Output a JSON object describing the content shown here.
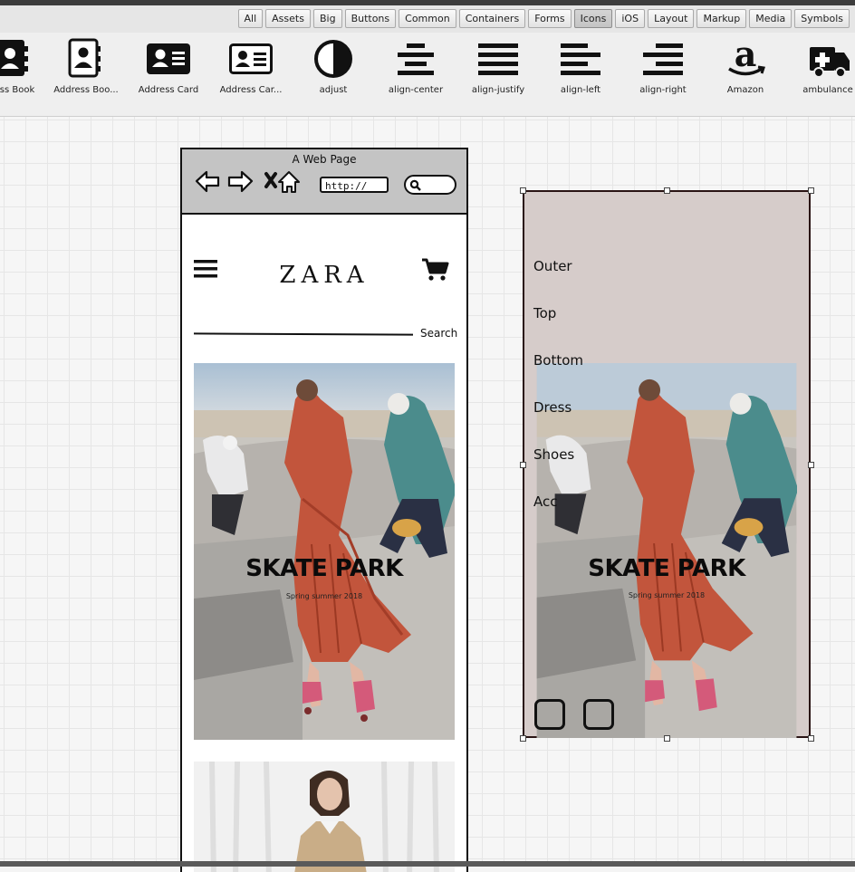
{
  "filter_tabs": [
    "All",
    "Assets",
    "Big",
    "Buttons",
    "Common",
    "Containers",
    "Forms",
    "Icons",
    "iOS",
    "Layout",
    "Markup",
    "Media",
    "Symbols"
  ],
  "active_filter": "Icons",
  "icon_library": [
    {
      "label": "ss Book",
      "icon": "address-book-icon"
    },
    {
      "label": "Address Boo...",
      "icon": "address-book-alt-icon"
    },
    {
      "label": "Address Card",
      "icon": "address-card-icon"
    },
    {
      "label": "Address Car...",
      "icon": "address-card-alt-icon"
    },
    {
      "label": "adjust",
      "icon": "adjust-icon"
    },
    {
      "label": "align-center",
      "icon": "align-center-icon"
    },
    {
      "label": "align-justify",
      "icon": "align-justify-icon"
    },
    {
      "label": "align-left",
      "icon": "align-left-icon"
    },
    {
      "label": "align-right",
      "icon": "align-right-icon"
    },
    {
      "label": "Amazon",
      "icon": "amazon-icon"
    },
    {
      "label": "ambulance",
      "icon": "ambulance-icon"
    }
  ],
  "browser": {
    "title": "A Web Page",
    "url": "http://"
  },
  "store": {
    "logo": "ZARA",
    "search_label": "Search",
    "hero_title": "SKATE PARK",
    "hero_subtitle": "Spring summer 2018"
  },
  "side_menu": {
    "items": [
      "Outer",
      "Top",
      "Bottom",
      "Dress",
      "Shoes",
      "Acc"
    ]
  }
}
